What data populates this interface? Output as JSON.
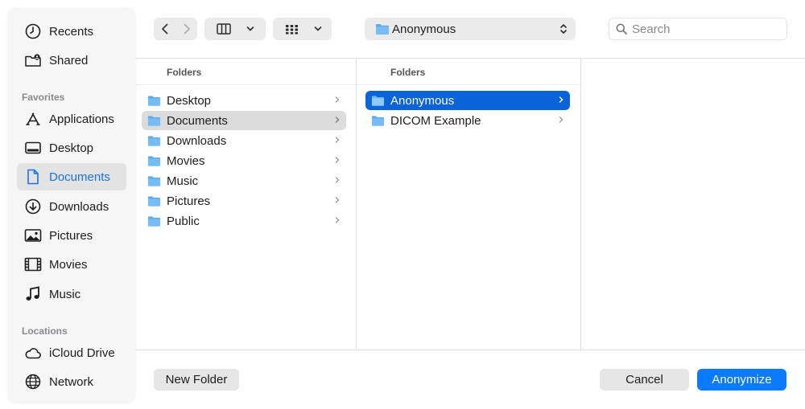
{
  "sidebar": {
    "top_items": [
      {
        "label": "Recents",
        "icon": "clock-icon"
      },
      {
        "label": "Shared",
        "icon": "shared-folder-icon"
      }
    ],
    "favorites_heading": "Favorites",
    "favorites": [
      {
        "label": "Applications",
        "icon": "applications-icon"
      },
      {
        "label": "Desktop",
        "icon": "desktop-icon"
      },
      {
        "label": "Documents",
        "icon": "document-icon",
        "selected": true
      },
      {
        "label": "Downloads",
        "icon": "download-icon"
      },
      {
        "label": "Pictures",
        "icon": "photo-icon"
      },
      {
        "label": "Movies",
        "icon": "film-icon"
      },
      {
        "label": "Music",
        "icon": "music-note-icon"
      }
    ],
    "locations_heading": "Locations",
    "locations": [
      {
        "label": "iCloud Drive",
        "icon": "cloud-icon"
      },
      {
        "label": "Network",
        "icon": "globe-icon"
      }
    ]
  },
  "toolbar": {
    "current_folder": "Anonymous",
    "search_placeholder": "Search"
  },
  "columns": [
    {
      "header": "Folders",
      "items": [
        "Desktop",
        "Documents",
        "Downloads",
        "Movies",
        "Music",
        "Pictures",
        "Public"
      ],
      "selected": "Documents"
    },
    {
      "header": "Folders",
      "items": [
        "Anonymous",
        "DICOM Example"
      ],
      "selected": "Anonymous"
    }
  ],
  "buttons": {
    "new_folder": "New Folder",
    "cancel": "Cancel",
    "confirm": "Anonymize"
  },
  "colors": {
    "accent": "#0a7aff",
    "selection": "#0a63d8",
    "folder": "#5aacf0"
  }
}
